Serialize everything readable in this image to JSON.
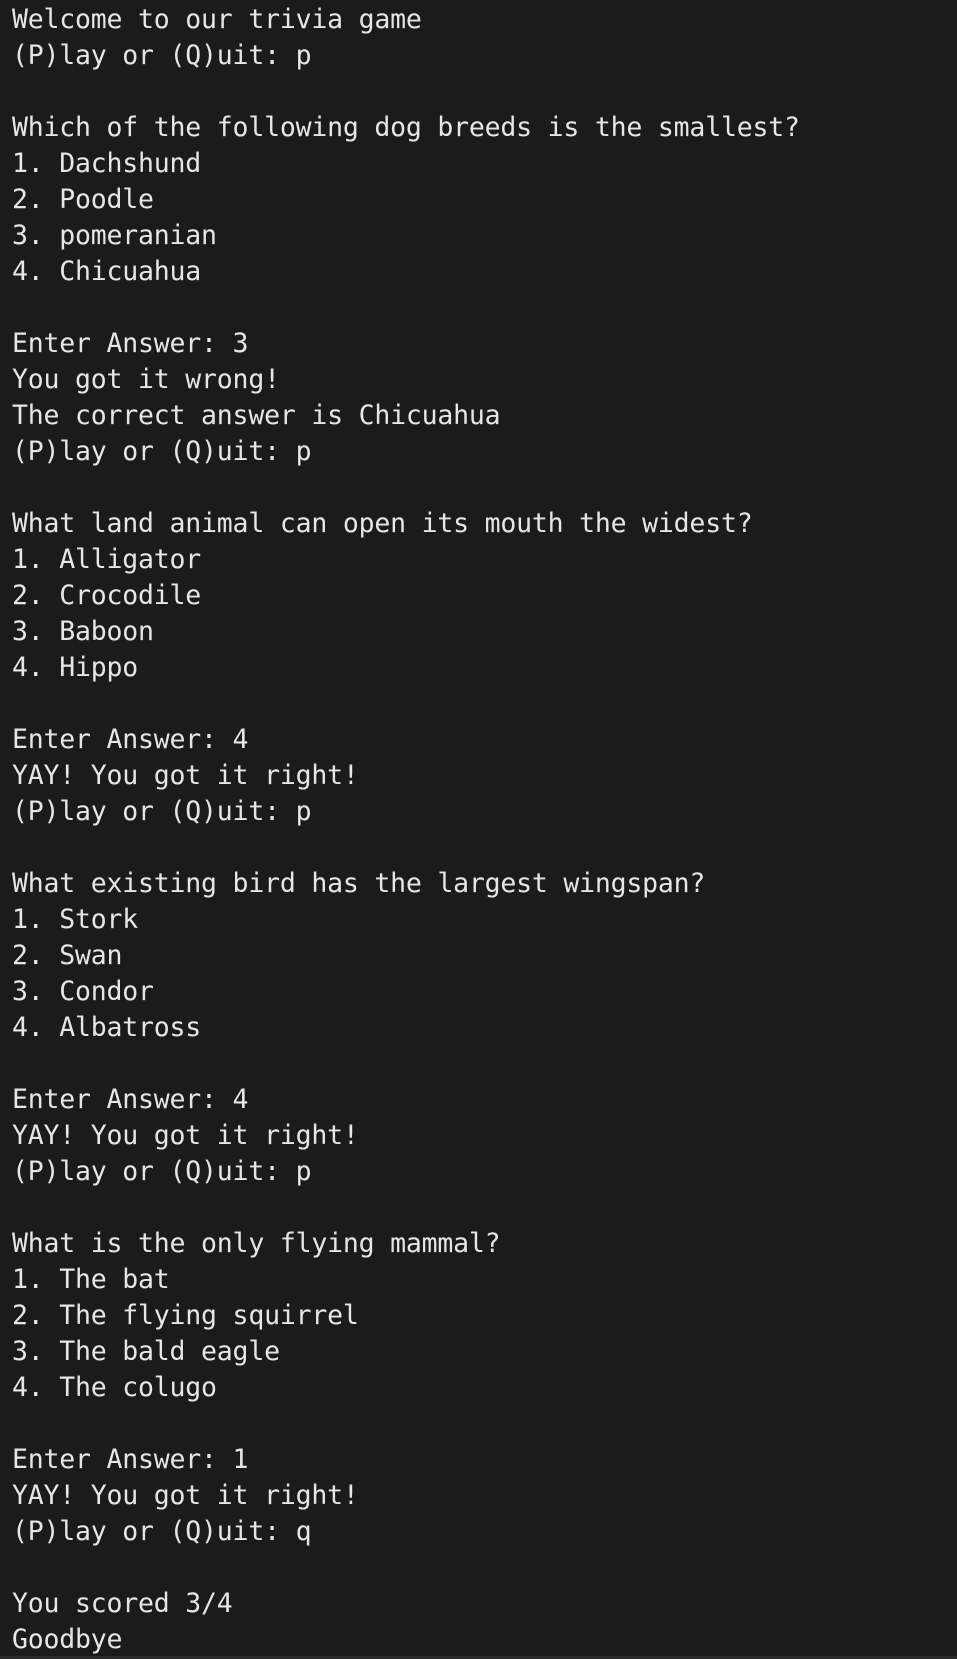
{
  "terminal": {
    "background": "#1b1b1b",
    "foreground": "#e6e6e6",
    "lines": [
      "Welcome to our trivia game",
      "(P)lay or (Q)uit: p",
      "",
      "Which of the following dog breeds is the smallest?",
      "1. Dachshund",
      "2. Poodle",
      "3. pomeranian",
      "4. Chicuahua",
      "",
      "Enter Answer: 3",
      "You got it wrong!",
      "The correct answer is Chicuahua",
      "(P)lay or (Q)uit: p",
      "",
      "What land animal can open its mouth the widest?",
      "1. Alligator",
      "2. Crocodile",
      "3. Baboon",
      "4. Hippo",
      "",
      "Enter Answer: 4",
      "YAY! You got it right!",
      "(P)lay or (Q)uit: p",
      "",
      "What existing bird has the largest wingspan?",
      "1. Stork",
      "2. Swan",
      "3. Condor",
      "4. Albatross",
      "",
      "Enter Answer: 4",
      "YAY! You got it right!",
      "(P)lay or (Q)uit: p",
      "",
      "What is the only flying mammal?",
      "1. The bat",
      "2. The flying squirrel",
      "3. The bald eagle",
      "4. The colugo",
      "",
      "Enter Answer: 1",
      "YAY! You got it right!",
      "(P)lay or (Q)uit: q",
      "",
      "You scored 3/4",
      "Goodbye"
    ]
  }
}
